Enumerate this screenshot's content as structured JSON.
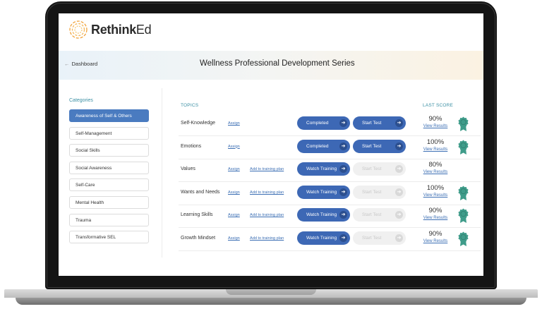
{
  "app": {
    "brand_bold": "Rethink",
    "brand_light": "Ed",
    "accent": "#4a7bc0",
    "teal": "#3a8fa3",
    "badge_color": "#3f9c8a"
  },
  "banner": {
    "back_label": "Dashboard",
    "title": "Wellness Professional Development Series"
  },
  "sidebar": {
    "heading": "Categories",
    "items": [
      {
        "label": "Awareness of Self & Others",
        "active": true
      },
      {
        "label": "Self-Management",
        "active": false
      },
      {
        "label": "Social Skills",
        "active": false
      },
      {
        "label": "Social Awareness",
        "active": false
      },
      {
        "label": "Self-Care",
        "active": false
      },
      {
        "label": "Mental Health",
        "active": false
      },
      {
        "label": "Trauma",
        "active": false
      },
      {
        "label": "Transformative SEL",
        "active": false
      }
    ]
  },
  "table": {
    "topics_header": "TOPICS",
    "score_header": "LAST SCORE",
    "assign_label": "Assign",
    "plan_label": "Add to training plan",
    "view_results_label": "View Results",
    "rows": [
      {
        "topic": "Self-Knowledge",
        "plan": false,
        "action": "Completed",
        "test": "Start Test",
        "test_enabled": true,
        "score": "90%",
        "badge": true
      },
      {
        "topic": "Emotions",
        "plan": false,
        "action": "Completed",
        "test": "Start Test",
        "test_enabled": true,
        "score": "100%",
        "badge": true
      },
      {
        "topic": "Values",
        "plan": true,
        "action": "Watch Training",
        "test": "Start Test",
        "test_enabled": false,
        "score": "80%",
        "badge": false
      },
      {
        "topic": "Wants and Needs",
        "plan": true,
        "action": "Watch Training",
        "test": "Start Test",
        "test_enabled": false,
        "score": "100%",
        "badge": true
      },
      {
        "topic": "Learning Skills",
        "plan": true,
        "action": "Watch Training",
        "test": "Start Test",
        "test_enabled": false,
        "score": "90%",
        "badge": true
      },
      {
        "topic": "Growth Mindset",
        "plan": true,
        "action": "Watch Training",
        "test": "Start Test",
        "test_enabled": false,
        "score": "90%",
        "badge": true
      }
    ]
  }
}
